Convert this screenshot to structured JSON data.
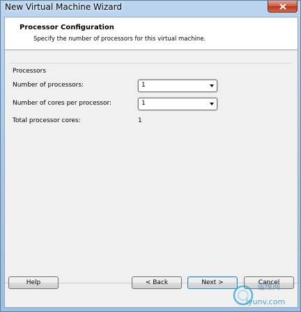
{
  "window": {
    "title": "New Virtual Machine Wizard",
    "close_icon": "close-icon"
  },
  "header": {
    "title": "Processor Configuration",
    "subtitle": "Specify the number of processors for this virtual machine."
  },
  "processors": {
    "group_label": "Processors",
    "num_processors_label": "Number of processors:",
    "num_processors_value": "1",
    "cores_per_processor_label": "Number of cores per processor:",
    "cores_per_processor_value": "1",
    "total_cores_label": "Total processor cores:",
    "total_cores_value": "1"
  },
  "buttons": {
    "help": "Help",
    "back": "< Back",
    "next": "Next >",
    "cancel": "Cancel"
  },
  "watermark": {
    "line1": "运维网",
    "line2": "iyunv.com"
  }
}
